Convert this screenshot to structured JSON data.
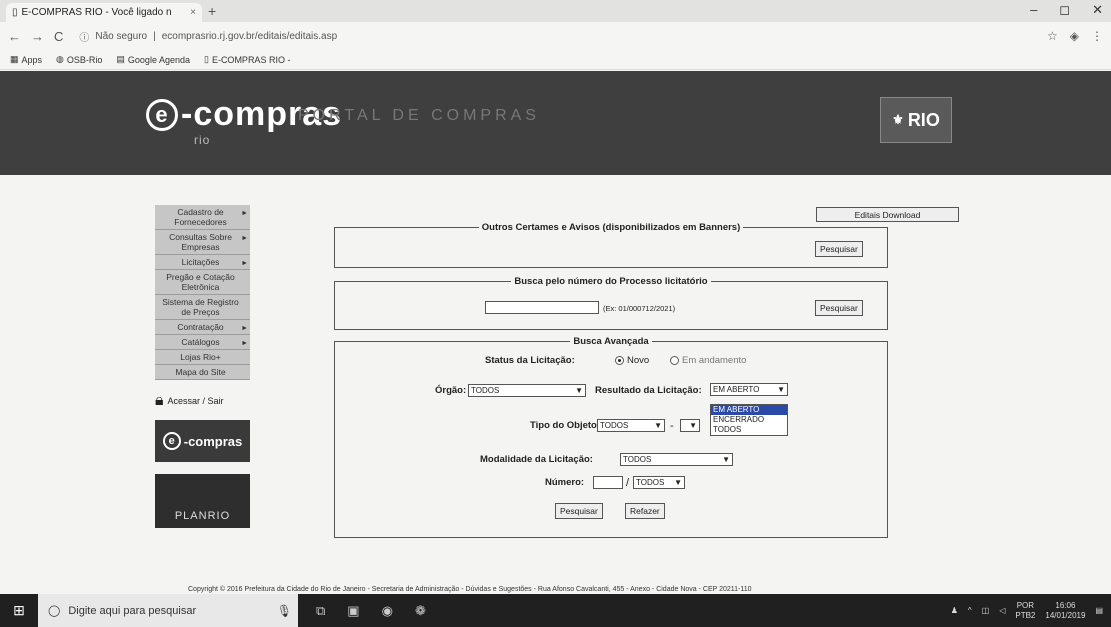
{
  "browser": {
    "tab_title": "E-COMPRAS RIO - Você ligado n",
    "tab_close": "×",
    "new_tab": "+",
    "win_min": "–",
    "win_max": "◻",
    "win_close": "✕",
    "nav_back": "←",
    "nav_forward": "→",
    "nav_reload": "C",
    "security_text": "Não seguro",
    "url": "ecomprasrio.rj.gov.br/editais/editais.asp",
    "bookmarks": [
      "Apps",
      "OSB-Rio",
      "Google Agenda",
      "E-COMPRAS RIO -"
    ]
  },
  "header": {
    "logo_text": "-compras",
    "logo_letter": "e",
    "logo_sub": "rio",
    "portal_title": "PORTAL DE COMPRAS",
    "rio_logo": "RIO",
    "rio_crest": "⚜"
  },
  "sidebar": {
    "items": [
      {
        "label": "Cadastro de Fornecedores"
      },
      {
        "label": "Consultas Sobre Empresas"
      },
      {
        "label": "Licitações"
      },
      {
        "label": "Pregão e Cotação Eletrônica"
      },
      {
        "label": "Sistema de Registro de Preços"
      },
      {
        "label": "Contratação"
      },
      {
        "label": "Catálogos"
      },
      {
        "label": "Lojas Rio+"
      },
      {
        "label": "Mapa do Site"
      }
    ],
    "login": "Acessar / Sair",
    "brand_ecompras": "-compras",
    "brand_letter": "e",
    "brand_planrio": "PLANRIO"
  },
  "main": {
    "edital_button": "Editais Download",
    "section1": {
      "legend": "Outros Certames e Avisos (disponibilizados em Banners)",
      "button": "Pesquisar"
    },
    "section2": {
      "legend": "Busca pelo número do Processo licitatório",
      "hint": "(Ex: 01/000712/2021)",
      "button": "Pesquisar"
    },
    "section3": {
      "legend": "Busca Avançada",
      "status_label": "Status da Licitação:",
      "status_options": [
        "Novo",
        "Em andamento"
      ],
      "orgao_label": "Órgão:",
      "orgao_value": "TODOS",
      "resultado_label": "Resultado da Licitação:",
      "resultado_value": "EM ABERTO",
      "resultado_options": [
        "EM ABERTO",
        "ENCERRADO",
        "TODOS"
      ],
      "tipo_label": "Tipo do Objeto:",
      "tipo_value": "TODOS",
      "tipo_sep": "-",
      "modalidade_label": "Modalidade da Licitação:",
      "modalidade_value": "TODOS",
      "numero_label": "Número:",
      "numero_sep": "/",
      "numero_year": "TODOS",
      "search_button": "Pesquisar",
      "reset_button": "Refazer"
    }
  },
  "footer": {
    "text": "Copyright © 2016 Prefeitura da Cidade do Rio de Janeiro - Secretaria de Administração - Dúvidas e Sugestões - Rua Afonso Cavalcanti, 455 - Anexo - Cidade Nova - CEP 20211-110"
  },
  "taskbar": {
    "search_placeholder": "Digite aqui para pesquisar",
    "start_glyph": "⊞",
    "clock_time": "16:06",
    "clock_date": "14/01/2019",
    "lang_top": "POR",
    "lang_bottom": "PTB2"
  }
}
